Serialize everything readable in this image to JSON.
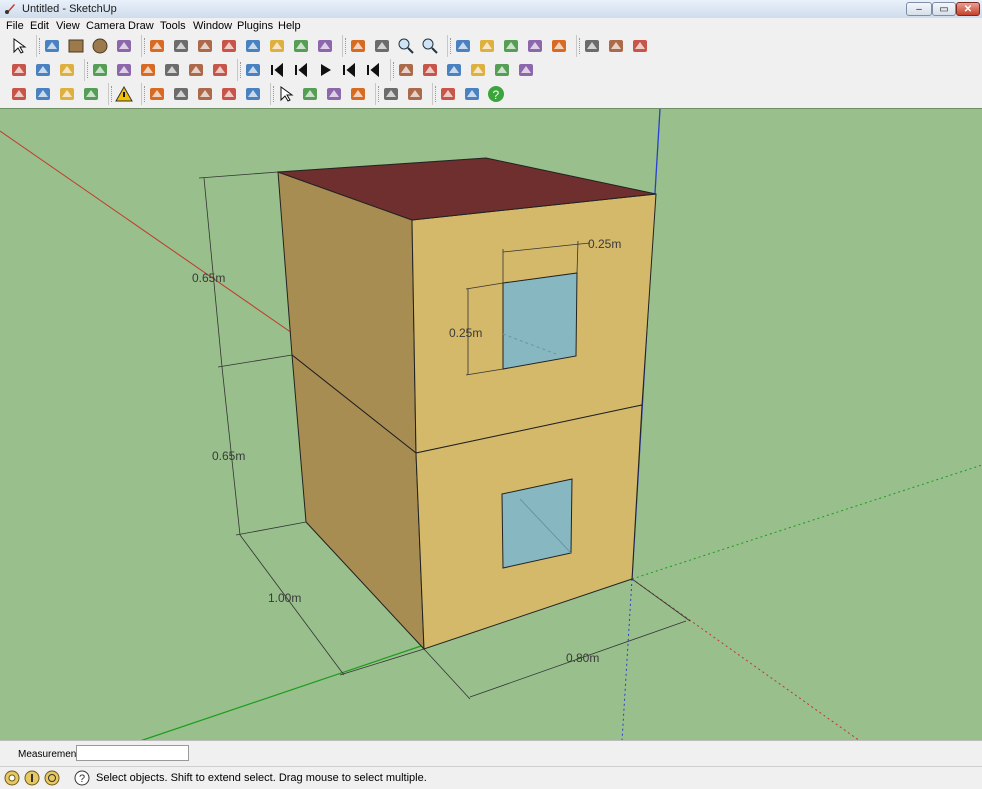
{
  "window": {
    "title": "Untitled - SketchUp",
    "min": "–",
    "max": "▭",
    "close": "✕"
  },
  "menu": [
    "File",
    "Edit",
    "View",
    "Camera",
    "Draw",
    "Tools",
    "Window",
    "Plugins",
    "Help"
  ],
  "toolbar": {
    "row1": [
      "select-icon",
      "pencil-icon",
      "rectangle-icon",
      "circle-icon",
      "arc-icon",
      "push-pull-icon",
      "eraser-icon",
      "paint-bucket-icon",
      "tape-measure-icon",
      "move-icon",
      "rotate-icon",
      "scale-icon",
      "follow-me-icon",
      "orbit-icon",
      "pan-icon",
      "zoom-icon",
      "zoom-extents-icon",
      "section-icon",
      "warehouse-icon",
      "position-camera-icon",
      "walk-icon",
      "look-around-icon",
      "components-icon",
      "materials-icon",
      "model-info-icon"
    ],
    "row2": [
      "iso-view-icon",
      "top-view-icon",
      "front-view-icon",
      "house-shaded-icon",
      "house-texture-icon",
      "house-mono-icon",
      "styles-icon",
      "layers-icon",
      "colors-icon",
      "animation-icon",
      "first-scene-icon",
      "prev-scene-icon",
      "play-icon",
      "next-scene-icon",
      "last-scene-icon",
      "dimension-icon",
      "axes-icon",
      "protractor-icon",
      "text-icon",
      "3d-axes-icon",
      "3d-text-icon"
    ],
    "row3": [
      "get-models-icon",
      "share-model-icon",
      "photo-icon",
      "export-icon",
      "warning-icon",
      "solid-icon",
      "sandbox-icon",
      "plugin-icon",
      "target-icon",
      "grid-icon",
      "select-tool-icon",
      "shadow-icon",
      "fog-icon",
      "binoculars-icon",
      "swap-icon",
      "wrench-icon",
      "energy-plus-icon",
      "globe-icon",
      "help-icon"
    ]
  },
  "model": {
    "dimensions": {
      "upper_height": "0.65m",
      "lower_height": "0.65m",
      "depth": "1.00m",
      "width": "0.80m",
      "window_width": "0.25m",
      "window_height": "0.25m"
    },
    "colors": {
      "background": "#98bf8c",
      "front_face": "#d4b96a",
      "side_face": "#a88d52",
      "roof": "#6e2f2e",
      "window": "#87b7c0",
      "axis_red": "#c0392b",
      "axis_green": "#1c9c1c",
      "axis_blue": "#2a3fd0"
    }
  },
  "measurements": {
    "label": "Measurements",
    "value": ""
  },
  "status": {
    "message": "Select objects. Shift to extend select. Drag mouse to select multiple."
  }
}
